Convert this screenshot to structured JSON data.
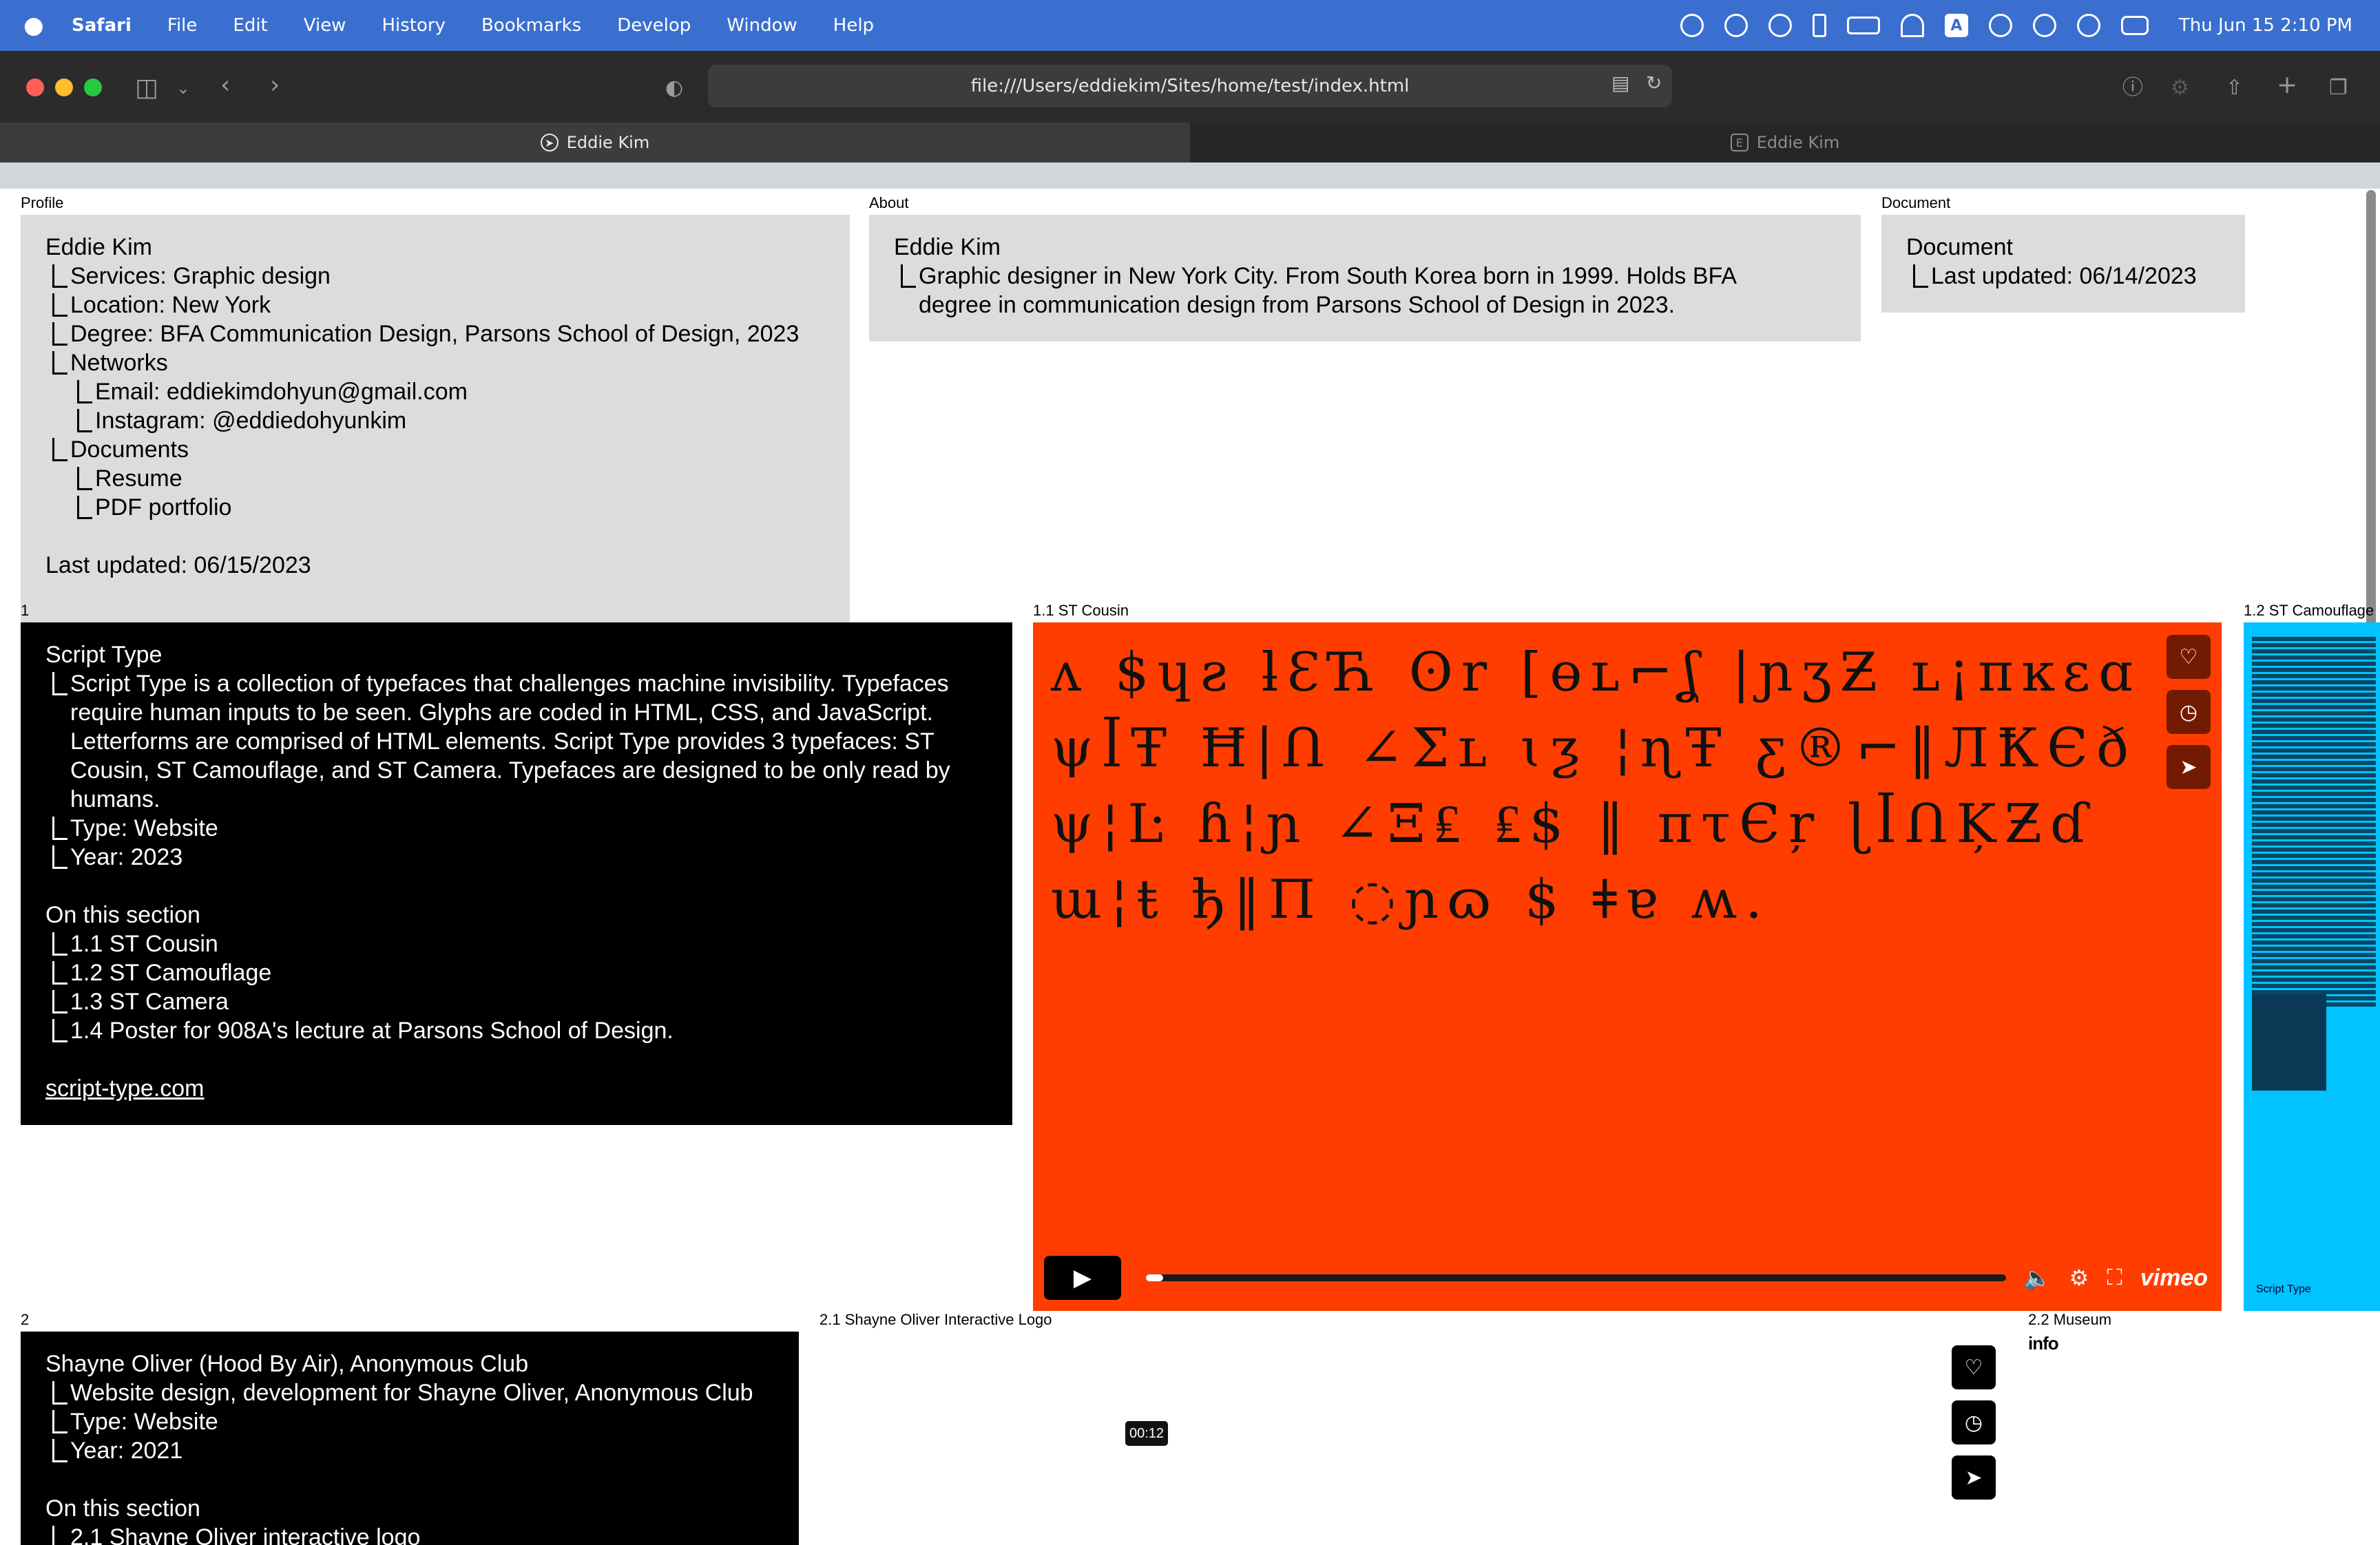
{
  "menubar": {
    "app": "Safari",
    "items": [
      "File",
      "Edit",
      "View",
      "History",
      "Bookmarks",
      "Develop",
      "Window",
      "Help"
    ],
    "clock": "Thu Jun 15  2:10 PM",
    "input_badge": "A"
  },
  "browser": {
    "url": "file:///Users/eddiekim/Sites/home/test/index.html",
    "tabs": [
      {
        "title": "Eddie Kim",
        "icon": "compass-icon"
      },
      {
        "title": "Eddie Kim",
        "icon": "E"
      }
    ]
  },
  "profile": {
    "label": "Profile",
    "name": "Eddie Kim",
    "services": "Services: Graphic design",
    "location": "Location: New York",
    "degree": "Degree: BFA Communication Design, Parsons School of Design, 2023",
    "networks": "Networks",
    "email": "Email: eddiekimdohyun@gmail.com",
    "instagram": "Instagram: @eddiedohyunkim",
    "documents": "Documents",
    "resume": "Resume",
    "portfolio": "PDF portfolio",
    "updated": "Last updated: 06/15/2023"
  },
  "about": {
    "label": "About",
    "name": "Eddie Kim",
    "bio_line1": "Graphic designer in New York City. From South Korea born in 1999. Holds BFA",
    "bio_line2": "degree in communication design from Parsons School of Design in 2023."
  },
  "document": {
    "label": "Document",
    "title": "Document",
    "updated": "Last updated: 06/14/2023"
  },
  "section1": {
    "label": "1",
    "title": "Script Type",
    "desc_lines": [
      "Script Type is a collection of typefaces that challenges machine invisibility. Typefaces",
      "require human inputs to be seen. Glyphs are coded in HTML, CSS, and JavaScript.",
      "Letterforms are comprised of HTML elements. Script Type provides 3 typefaces: ST",
      "Cousin, ST Camouflage, and ST Camera. Typefaces are designed to be only read by",
      "humans."
    ],
    "type": "Type: Website",
    "year": "Year: 2023",
    "on_section": "On this section",
    "items": [
      "1.1 ST Cousin",
      "1.2 ST Camouflage",
      "1.3 ST Camera",
      "1.4 Poster for 908A's lecture at Parsons School of Design."
    ],
    "link": "script-type.com"
  },
  "st_cousin": {
    "label": "1.1 ST Cousin",
    "glyph_text": "ʌ  $ɥƨ ƚƐЋ ʘr [ɵʟ⌐ʆ |ɲʒƵ ʟ¡πĸɛɑ ψꟾŦ Ħ|Ո ∠Σʟ ɩƺ ¦ɳŦ ƹ®⌐‖ЛҞЄð ψ¦Ŀ ɦ¦ɲ ∠Ξ₤ ₤$ ‖ πτЄŗ ɭꟾՈĶƵɗ ɯ¦ŧ ђ‖Π ◌ɲɷ $ ǂɐ ʍ.",
    "time": "00:12",
    "progress": 0.02,
    "brand": "vimeo"
  },
  "st_camouflage": {
    "label": "1.2 ST Camouflage",
    "caption": "Script Type"
  },
  "section2": {
    "label": "2",
    "title": "Shayne Oliver (Hood By Air), Anonymous Club",
    "desc": "Website design, development for Shayne Oliver, Anonymous Club",
    "type": "Type: Website",
    "year": "Year: 2021",
    "on_section": "On this section",
    "item1": "2.1 Shayne Oliver interactive logo"
  },
  "logo_panel": {
    "label": "2.1 Shayne Oliver Interactive Logo"
  },
  "museum_panel": {
    "label": "2.2 Museum",
    "info": "info"
  },
  "colors": {
    "menubar": "#3a6fd0",
    "video_bg": "#ff3d00",
    "camo_bg": "#00c3ff",
    "panel_grey": "#dcdcdc"
  }
}
